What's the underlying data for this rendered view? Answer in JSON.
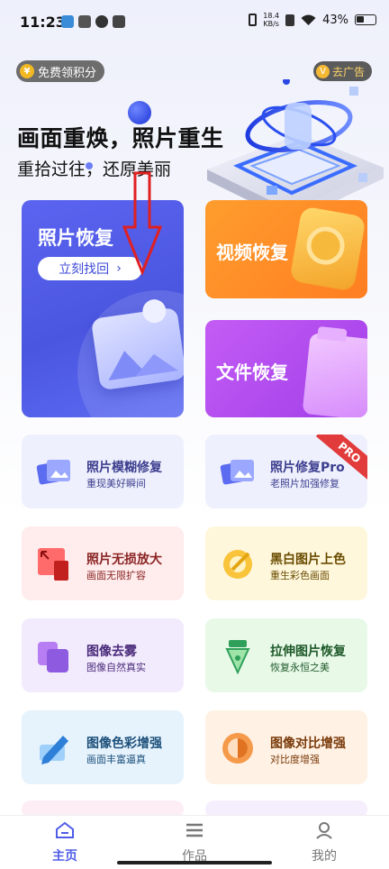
{
  "status_bar": {
    "time": "11:23",
    "net_speed_value": "18.4",
    "net_speed_unit": "KB/s",
    "battery": "43%"
  },
  "top": {
    "points_label": "免费领积分",
    "coin_glyph": "¥",
    "ad_label": "去广告",
    "ad_glyph": "V"
  },
  "hero": {
    "title": "画面重焕，照片重生",
    "subtitle": "重拾过往，还原美丽"
  },
  "main_cards": {
    "photo": {
      "title": "照片恢复",
      "button": "立刻找回",
      "button_chevron": "›"
    },
    "video": {
      "title": "视频恢复"
    },
    "file": {
      "title": "文件恢复"
    }
  },
  "tiles": [
    {
      "title": "照片模糊修复",
      "subtitle": "重现美好瞬间",
      "icon": "photo-stack-icon",
      "bg": "#eef0fd",
      "title_color": "#3d3f8f",
      "sub_color": "#3d3f8f"
    },
    {
      "title": "照片修复Pro",
      "subtitle": "老照片加强修复",
      "icon": "photo-stack-icon",
      "bg": "#eef0fd",
      "title_color": "#3d3f8f",
      "sub_color": "#3d3f8f",
      "badge": "PRO"
    },
    {
      "title": "照片无损放大",
      "subtitle": "画面无限扩容",
      "icon": "enlarge-icon",
      "bg": "#ffecec",
      "title_color": "#8a2424",
      "sub_color": "#8a2424"
    },
    {
      "title": "黑白图片上色",
      "subtitle": "重生彩色画面",
      "icon": "colorize-icon",
      "bg": "#fff7dc",
      "title_color": "#6a4c00",
      "sub_color": "#6a4c00"
    },
    {
      "title": "图像去雾",
      "subtitle": "图像自然真实",
      "icon": "defog-icon",
      "bg": "#f2eafd",
      "title_color": "#4a2b7a",
      "sub_color": "#4a2b7a"
    },
    {
      "title": "拉伸图片恢复",
      "subtitle": "恢复永恒之美",
      "icon": "pen-nib-icon",
      "bg": "#e8f9e8",
      "title_color": "#1f5a2a",
      "sub_color": "#1f5a2a"
    },
    {
      "title": "图像色彩增强",
      "subtitle": "画面丰富逼真",
      "icon": "pencil-icon",
      "bg": "#e6f3fd",
      "title_color": "#1c4f7a",
      "sub_color": "#1c4f7a"
    },
    {
      "title": "图像对比增强",
      "subtitle": "对比度增强",
      "icon": "contrast-icon",
      "bg": "#fff1e4",
      "title_color": "#7a3b0b",
      "sub_color": "#7a3b0b"
    }
  ],
  "bottom_nav": [
    {
      "label": "主页",
      "icon": "home-icon",
      "active": true
    },
    {
      "label": "作品",
      "icon": "list-icon",
      "active": false
    },
    {
      "label": "我的",
      "icon": "user-icon",
      "active": false
    }
  ],
  "colors": {
    "accent": "#4f5de8",
    "photo_card": "#4a56e0",
    "video_card": "#ff8a27",
    "file_card": "#b04cf0",
    "annotation_arrow": "#e02020"
  }
}
